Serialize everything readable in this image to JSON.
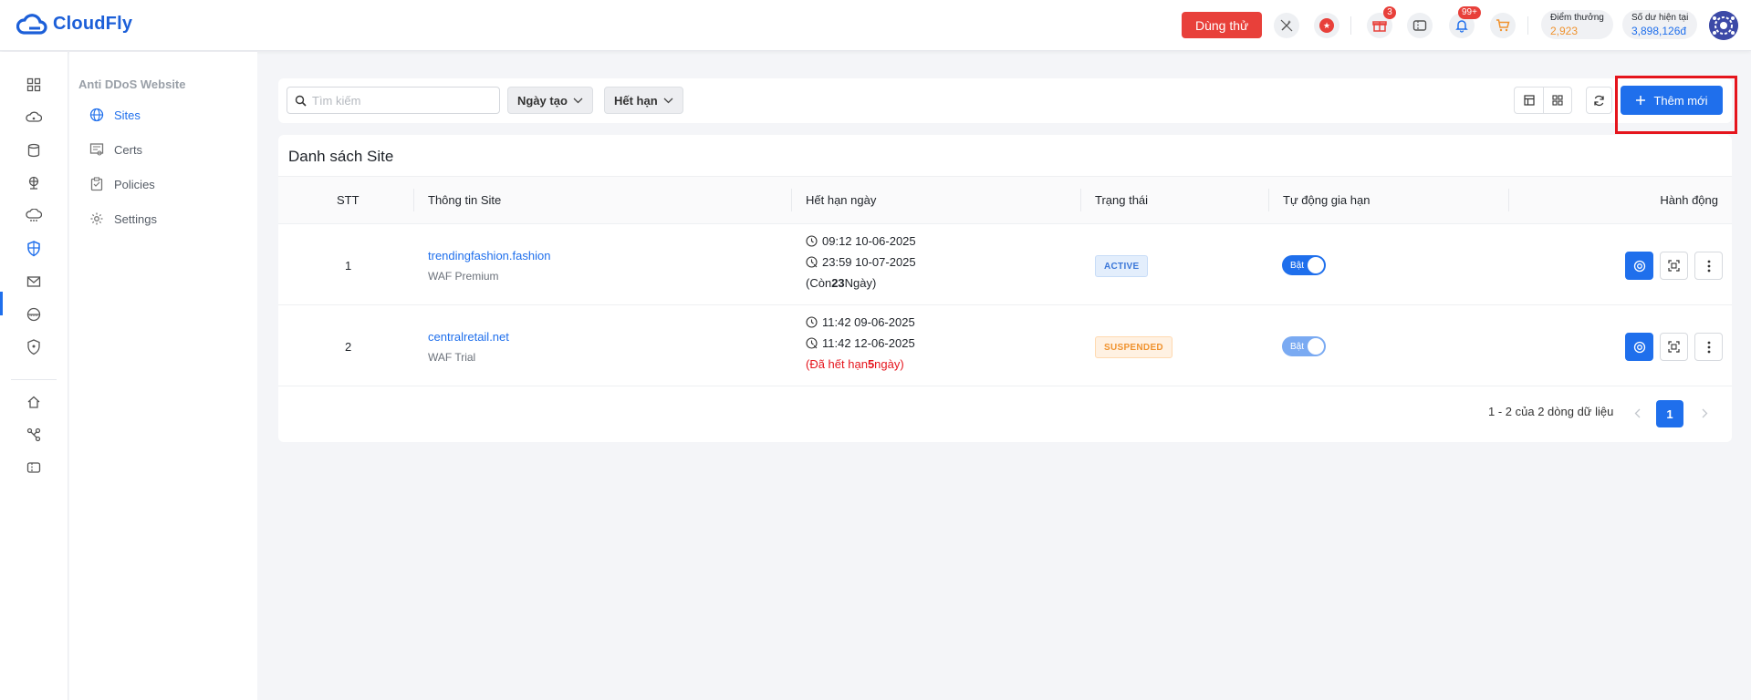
{
  "header": {
    "brand": "CloudFly",
    "trial_button": "Dùng thử",
    "gift_badge": "3",
    "notifications_badge": "99+",
    "reward_label": "Điểm thưởng",
    "reward_value": "2,923",
    "balance_label": "Số dư hiện tại",
    "balance_value": "3,898,126đ"
  },
  "rail": {
    "icons": [
      "dashboard-icon",
      "cloud-server-icon",
      "database-icon",
      "network-icon",
      "cloud-storage-icon",
      "shield-icon",
      "mail-icon",
      "www-icon",
      "security-icon",
      "home-cloud-icon",
      "connection-icon",
      "ticket-icon"
    ],
    "active": "shield-icon"
  },
  "submenu": {
    "title": "Anti DDoS Website",
    "items": [
      {
        "label": "Sites",
        "icon": "globe-icon",
        "active": true
      },
      {
        "label": "Certs",
        "icon": "certificate-icon",
        "active": false
      },
      {
        "label": "Policies",
        "icon": "clipboard-icon",
        "active": false
      },
      {
        "label": "Settings",
        "icon": "gear-icon",
        "active": false
      }
    ]
  },
  "filters": {
    "search_placeholder": "Tìm kiếm",
    "created_label": "Ngày tạo",
    "expiry_label": "Hết hạn",
    "add_label": "Thêm mới"
  },
  "table": {
    "title": "Danh sách Site",
    "columns": [
      "STT",
      "Thông tin Site",
      "Hết hạn ngày",
      "Trạng thái",
      "Tự động gia hạn",
      "Hành động"
    ],
    "rows": [
      {
        "stt": "1",
        "domain": "trendingfashion.fashion",
        "plan": "WAF Premium",
        "start": "09:12 10-06-2025",
        "end": "23:59 10-07-2025",
        "remain_prefix": "(Còn ",
        "remain_days": "23",
        "remain_suffix": " Ngày)",
        "status": "ACTIVE",
        "auto_renew": "Bật"
      },
      {
        "stt": "2",
        "domain": "centralretail.net",
        "plan": "WAF Trial",
        "start": "11:42 09-06-2025",
        "end": "11:42 12-06-2025",
        "remain_prefix": "(Đã hết hạn ",
        "remain_days": "5",
        "remain_suffix": " ngày)",
        "status": "SUSPENDED",
        "auto_renew": "Bật"
      }
    ],
    "pagination_text": "1 - 2 của 2 dòng dữ liệu",
    "current_page": "1"
  },
  "colors": {
    "primary": "#1f6fec",
    "danger": "#e8403a",
    "highlight": "#e5151d",
    "reward": "#f0932f"
  }
}
